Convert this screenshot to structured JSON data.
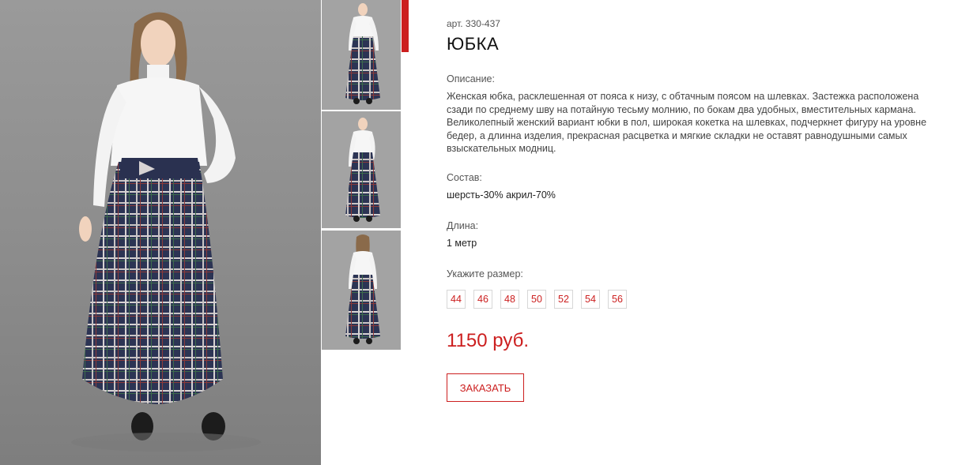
{
  "product": {
    "article": "арт. 330-437",
    "title": "ЮБКА",
    "description_label": "Описание:",
    "description": "Женская юбка, расклешенная от пояса к низу, с обтачным поясом на шлевках. Застежка расположена сзади по среднему шву на потайную тесьму молнию, по бокам два удобных, вместительных кармана. Великолепный женский вариант юбки в пол, широкая кокетка на шлевках, подчеркнет фигуру на уровне бедер, а длинна изделия, прекрасная расцветка и мягкие складки не оставят равнодушными самых взыскательных модниц.",
    "composition_label": "Состав:",
    "composition": "шерсть-30% акрил-70%",
    "length_label": "Длина:",
    "length": "1 метр",
    "size_label": "Укажите размер:",
    "sizes": [
      "44",
      "46",
      "48",
      "50",
      "52",
      "54",
      "56"
    ],
    "price": "1150 руб.",
    "order_button": "ЗАКАЗАТЬ"
  },
  "colors": {
    "accent": "#cc1f1f",
    "photo_bg": "#8f8f8f",
    "skirt": "#2c3454"
  },
  "images": {
    "main": "model-photo-front",
    "thumbnails": [
      "thumb-front",
      "thumb-front-pose",
      "thumb-back"
    ]
  }
}
